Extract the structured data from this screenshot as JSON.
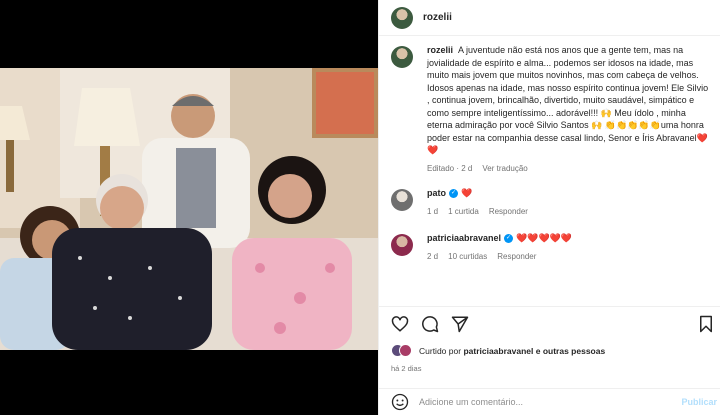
{
  "post": {
    "username": "rozelii",
    "caption_username": "rozelii",
    "caption": "A juventude não está nos anos que a gente tem, mas na jovialidade de espírito e alma... podemos ser idosos na idade, mas muito mais jovem que muitos novinhos, mas com cabeça de velhos. Idosos apenas na idade, mas nosso espírito continua jovem! Ele Silvio , continua jovem, brincalhão, divertido, muito saudável, simpático e como sempre inteligentíssimo... adorável!!! 🙌 Meu ídolo , minha eterna admiração por você Silvio Santos 🙌 👏👏👏👏👏uma honra poder estar na companhia desse casal lindo, Senor e Íris Abravanel❤️❤️",
    "caption_time": "Editado · 2 d",
    "see_translation": "Ver tradução"
  },
  "comments": [
    {
      "username": "pato",
      "verified": true,
      "text": "❤️",
      "time": "1 d",
      "likes": "1 curtida",
      "reply": "Responder"
    },
    {
      "username": "patriciaabravanel",
      "verified": true,
      "text": "❤️❤️❤️❤️❤️",
      "time": "2 d",
      "likes": "10 curtidas",
      "reply": "Responder"
    }
  ],
  "liked_by": {
    "prefix": "Curtido por",
    "user": "patriciaabravanel",
    "suffix": "e outras pessoas"
  },
  "posted_ago": "há 2 dias",
  "add_comment": {
    "placeholder": "Adicione um comentário...",
    "publish": "Publicar"
  },
  "icons": [
    "heart-icon",
    "comment-icon",
    "share-icon",
    "bookmark-icon",
    "emoji-icon"
  ],
  "colors": {
    "verified": "#0095f6",
    "heart": "#ed1c34",
    "publish": "#b2dffc"
  }
}
